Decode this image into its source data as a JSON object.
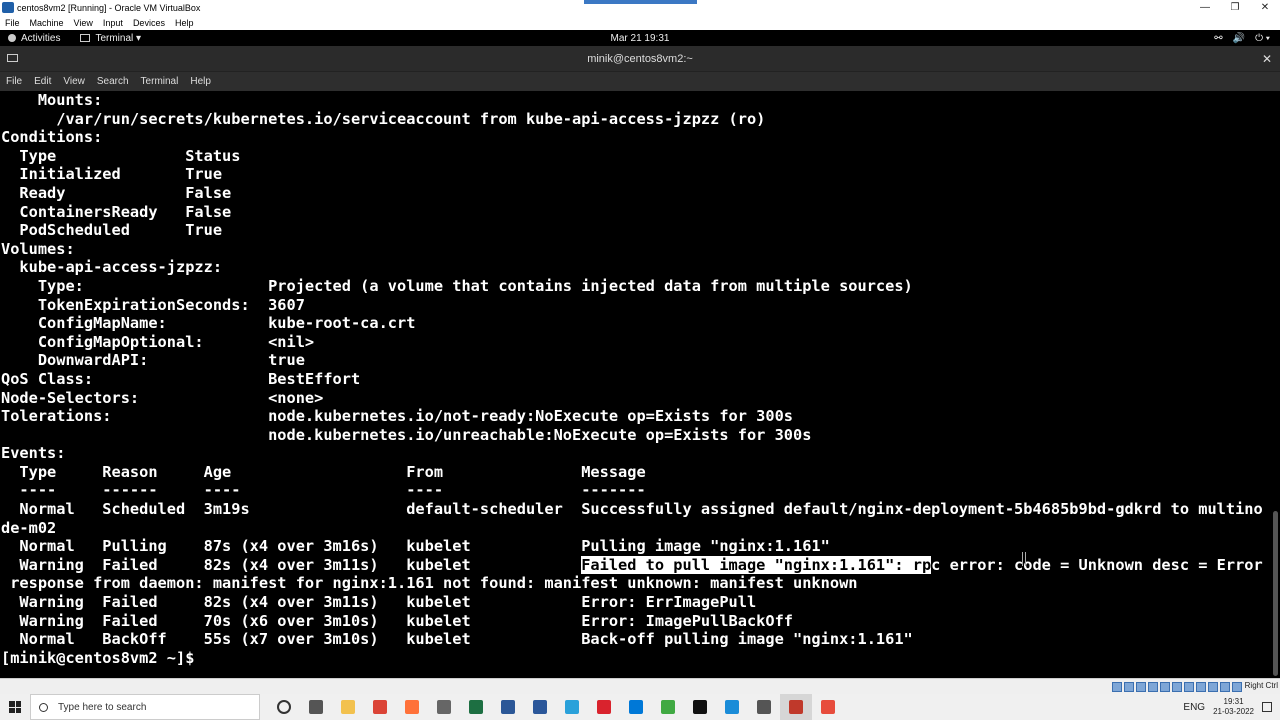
{
  "vbox": {
    "title": "centos8vm2 [Running] - Oracle VM VirtualBox",
    "menu": [
      "File",
      "Machine",
      "View",
      "Input",
      "Devices",
      "Help"
    ],
    "minimize": "—",
    "restore": "❐",
    "close": "✕",
    "host_key": "Right Ctrl"
  },
  "gnome": {
    "activities": "Activities",
    "app": "Terminal ▾",
    "clock": "Mar 21  19:31",
    "tray": [
      "⚯",
      "🔊",
      "⏻ ▾"
    ]
  },
  "terminal": {
    "window_title": "minik@centos8vm2:~",
    "close": "✕",
    "menu": [
      "File",
      "Edit",
      "View",
      "Search",
      "Terminal",
      "Help"
    ],
    "lines_before": [
      "    Mounts:",
      "      /var/run/secrets/kubernetes.io/serviceaccount from kube-api-access-jzpzz (ro)",
      "Conditions:",
      "  Type              Status",
      "  Initialized       True",
      "  Ready             False",
      "  ContainersReady   False",
      "  PodScheduled      True",
      "Volumes:",
      "  kube-api-access-jzpzz:",
      "    Type:                    Projected (a volume that contains injected data from multiple sources)",
      "    TokenExpirationSeconds:  3607",
      "    ConfigMapName:           kube-root-ca.crt",
      "    ConfigMapOptional:       <nil>",
      "    DownwardAPI:             true",
      "QoS Class:                   BestEffort",
      "Node-Selectors:              <none>",
      "Tolerations:                 node.kubernetes.io/not-ready:NoExecute op=Exists for 300s",
      "                             node.kubernetes.io/unreachable:NoExecute op=Exists for 300s",
      "Events:",
      "  Type     Reason     Age                   From               Message",
      "  ----     ------     ----                  ----               -------",
      "  Normal   Scheduled  3m19s                 default-scheduler  Successfully assigned default/nginx-deployment-5b4685b9bd-gdkrd to multino",
      "de-m02",
      "  Normal   Pulling    87s (x4 over 3m16s)   kubelet            Pulling image \"nginx:1.161\""
    ],
    "failed_prefix": "  Warning  Failed     82s (x4 over 3m11s)   kubelet            ",
    "failed_selected": "Failed to pull image \"nginx:1.161\": rp",
    "failed_rest": "c error: code = Unknown desc = Error",
    "lines_after": [
      " response from daemon: manifest for nginx:1.161 not found: manifest unknown: manifest unknown",
      "  Warning  Failed     82s (x4 over 3m11s)   kubelet            Error: ErrImagePull",
      "  Warning  Failed     70s (x6 over 3m10s)   kubelet            Error: ImagePullBackOff",
      "  Normal   BackOff    55s (x7 over 3m10s)   kubelet            Back-off pulling image \"nginx:1.161\"",
      "[minik@centos8vm2 ~]$ "
    ]
  },
  "taskbar": {
    "search_placeholder": "Type here to search",
    "language": "ENG",
    "time": "19:31",
    "date": "21-03-2022",
    "apps": [
      {
        "name": "cortana-icon",
        "color": "#333333"
      },
      {
        "name": "task-view-icon",
        "color": "#555555"
      },
      {
        "name": "file-explorer-icon",
        "color": "#f2c14e"
      },
      {
        "name": "chrome-icon",
        "color": "#db4437"
      },
      {
        "name": "firefox-icon",
        "color": "#ff7139"
      },
      {
        "name": "app-icon",
        "color": "#666666"
      },
      {
        "name": "excel-icon",
        "color": "#1d6f42"
      },
      {
        "name": "snipping-icon",
        "color": "#2b5797"
      },
      {
        "name": "word-icon",
        "color": "#2b579a"
      },
      {
        "name": "telegram-icon",
        "color": "#2aa1da"
      },
      {
        "name": "opera-icon",
        "color": "#d9232d"
      },
      {
        "name": "vscode-icon",
        "color": "#0078d7"
      },
      {
        "name": "camtasia-icon",
        "color": "#40a942"
      },
      {
        "name": "terminal-icon",
        "color": "#111111"
      },
      {
        "name": "edge-icon",
        "color": "#1a8cd8"
      },
      {
        "name": "virtualbox-icon",
        "color": "#555555"
      },
      {
        "name": "virtualbox-vm-icon",
        "color": "#c0392b"
      },
      {
        "name": "recorder-icon",
        "color": "#e74c3c"
      }
    ]
  }
}
